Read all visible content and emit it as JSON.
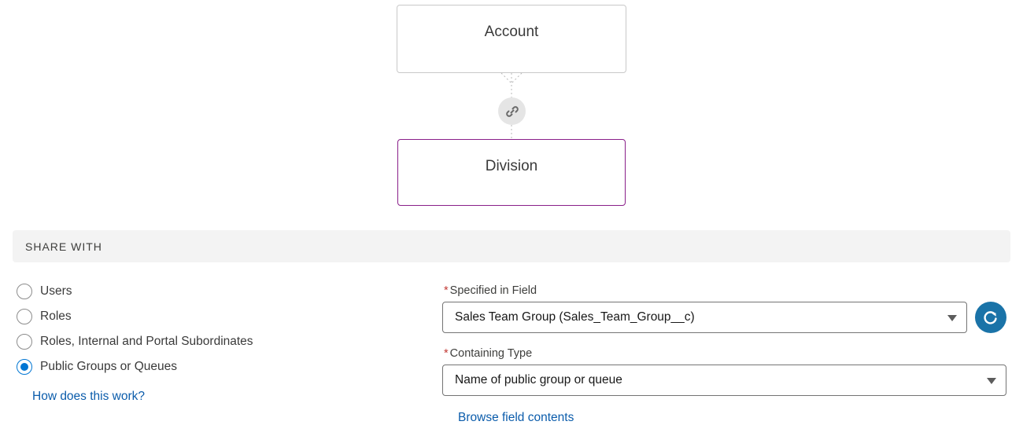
{
  "diagram": {
    "parent_object": "Account",
    "child_object": "Division"
  },
  "share_with": {
    "header": "SHARE WITH",
    "options": [
      {
        "label": "Users",
        "checked": false
      },
      {
        "label": "Roles",
        "checked": false
      },
      {
        "label": "Roles, Internal and Portal Subordinates",
        "checked": false
      },
      {
        "label": "Public Groups or Queues",
        "checked": true
      }
    ],
    "help_link": "How does this work?"
  },
  "fields": {
    "specified_in_field": {
      "required_marker": "*",
      "label": "Specified in Field",
      "value": "Sales Team Group (Sales_Team_Group__c)"
    },
    "containing_type": {
      "required_marker": "*",
      "label": "Containing Type",
      "value": "Name of public group or queue"
    },
    "browse_link": "Browse field contents"
  },
  "icons": {
    "link": "link-icon",
    "refresh": "refresh-icon",
    "dropdown": "chevron-down-icon"
  },
  "colors": {
    "accent_blue": "#0176d3",
    "link_blue": "#0b5cab",
    "refresh_button": "#1a73a8",
    "division_border": "#8a1f8a",
    "required_red": "#c23934"
  }
}
